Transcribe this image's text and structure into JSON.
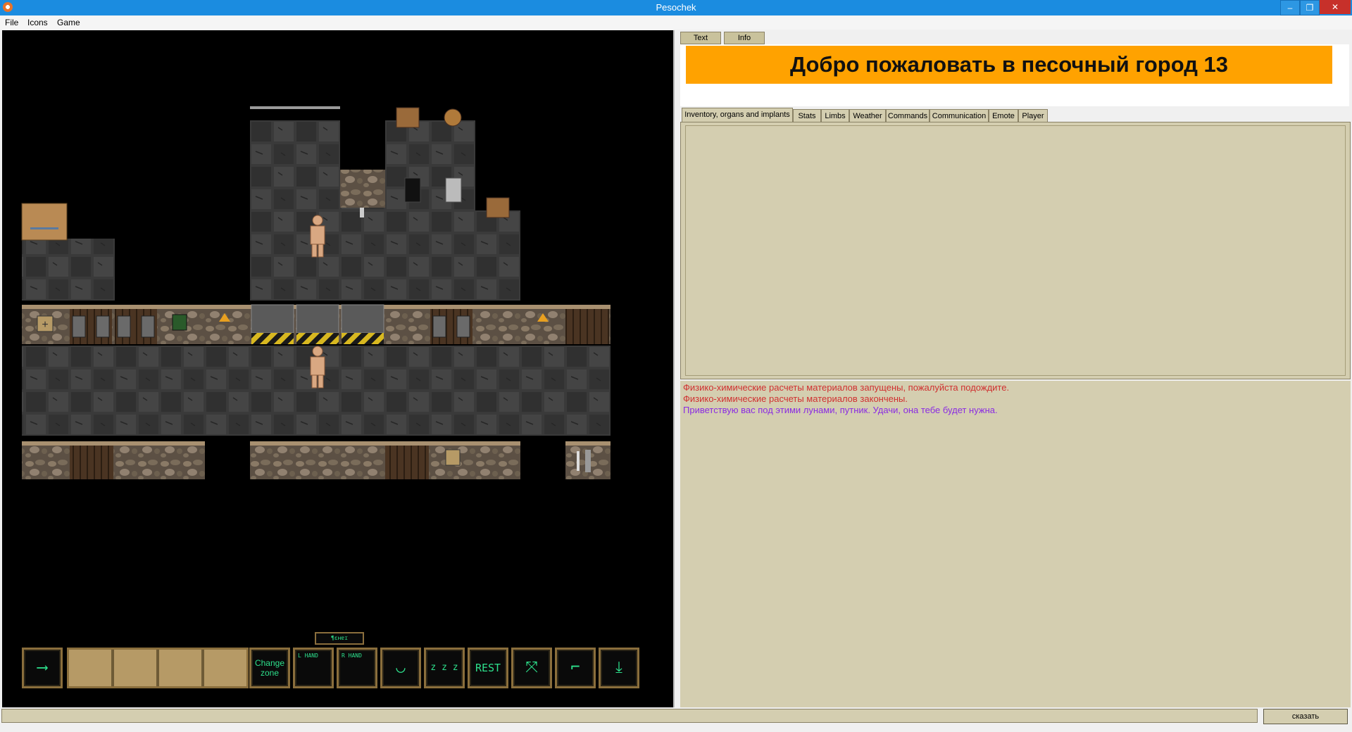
{
  "window": {
    "title": "Pesochek",
    "min_glyph": "–",
    "max_glyph": "❐",
    "close_glyph": "✕"
  },
  "menu": {
    "items": [
      "File",
      "Icons",
      "Game"
    ]
  },
  "hud": {
    "move_glyph": "⟶",
    "change_zone": [
      "Change",
      "zone"
    ],
    "left_hand": "L HAND",
    "right_hand": "R HAND",
    "top_indicator": "¶ɛʜɐɪ",
    "rest_label": "REST",
    "sleep_glyph": "z z z",
    "face_glyph": "◡",
    "icons": [
      "move-arrow-icon",
      "left-hand-icon",
      "right-hand-icon",
      "face-icon",
      "sleep-icon",
      "rest-icon",
      "pull-icon",
      "throw-icon",
      "drop-icon"
    ]
  },
  "right_panel": {
    "top_tabs": [
      "Text",
      "Info"
    ],
    "banner": "Добро пожаловать в песочный город 13",
    "sub_tabs": [
      "Inventory, organs and implants",
      "Stats",
      "Limbs",
      "Weather",
      "Commands",
      "Communication",
      "Emote",
      "Player"
    ],
    "messages": [
      {
        "text": "Физико-химические расчеты материалов запущены, пожалуйста подождите.",
        "color": "#d03030"
      },
      {
        "text": "Физико-химические расчеты материалов закончены.",
        "color": "#d03030"
      },
      {
        "text": "Приветствую вас под этими лунами, путник. Удачи, она тебе будет нужна.",
        "color": "#8a2be2"
      }
    ]
  },
  "input": {
    "value": "",
    "say_label": "сказать"
  },
  "colors": {
    "titlebar": "#1b8ce0",
    "banner": "#ffa200",
    "panel": "#d4ceb0",
    "hud_green": "#2de08c"
  }
}
